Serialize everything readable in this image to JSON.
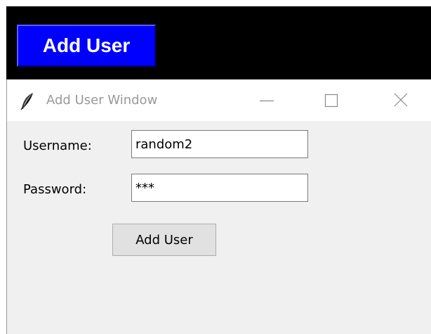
{
  "main_window": {
    "add_user_button": "Add User",
    "background": "#000000",
    "button_color": "#0000ff"
  },
  "popup": {
    "title": "Add User Window",
    "app_icon": "feather-icon",
    "titlebar_controls": [
      "minimize-icon",
      "maximize-icon",
      "close-icon"
    ],
    "form": {
      "username_label": "Username:",
      "username_value": "random2",
      "password_label": "Password:",
      "password_value": "***",
      "submit_label": "Add User"
    }
  }
}
